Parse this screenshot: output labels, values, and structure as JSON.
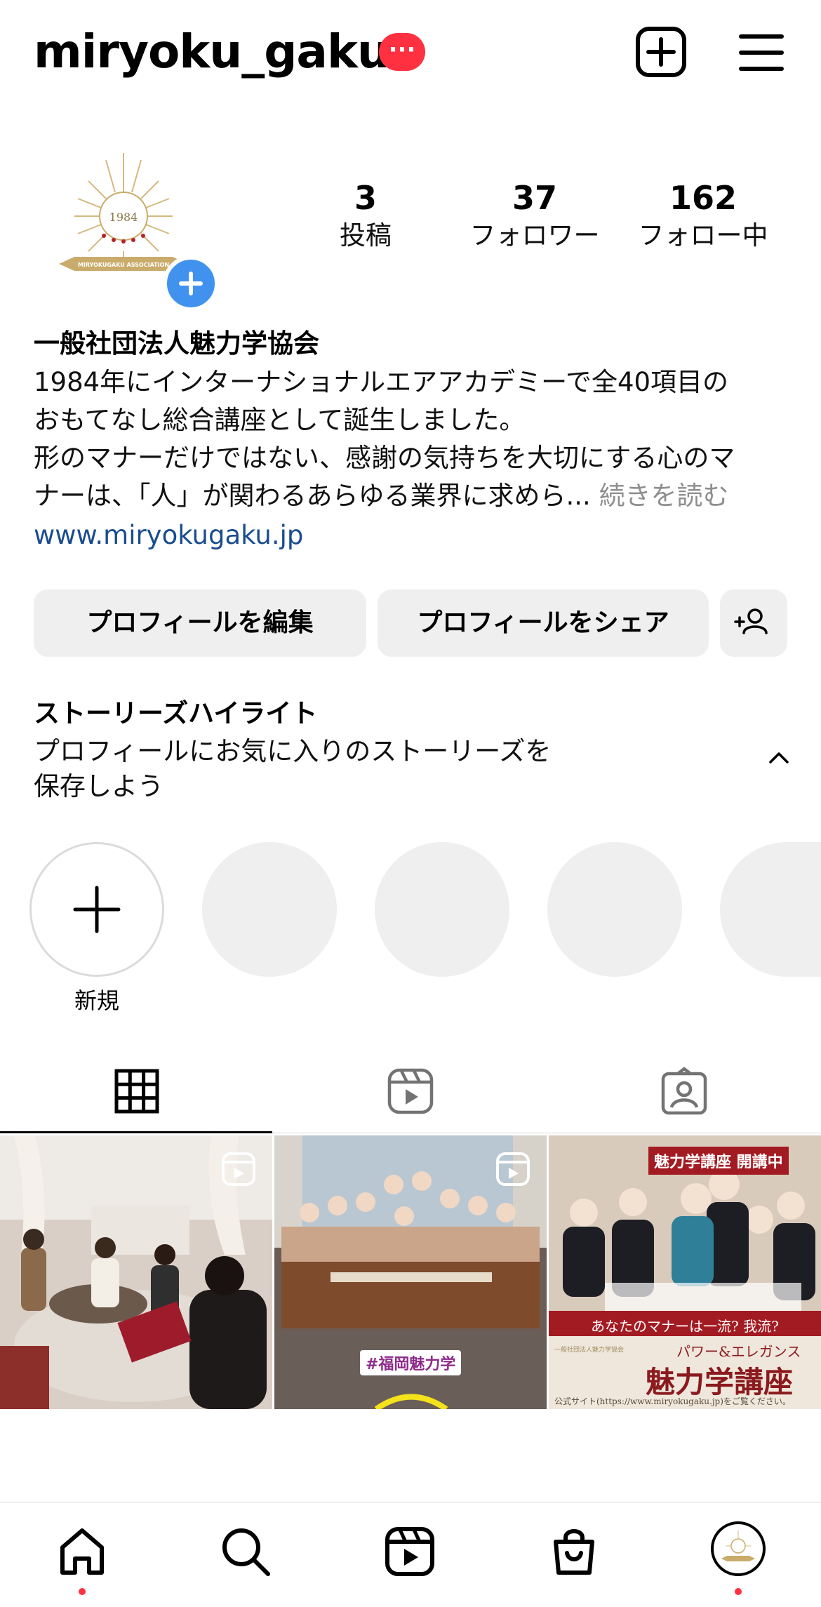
{
  "header": {
    "username": "miryoku_gaku",
    "badge": "···",
    "icons": [
      "create-icon",
      "menu-icon"
    ]
  },
  "profile": {
    "avatar_year": "1984",
    "avatar_ribbon": "MIRYOKUGAKU ASSOCIATION",
    "stats": [
      {
        "value": "3",
        "label": "投稿"
      },
      {
        "value": "37",
        "label": "フォロワー"
      },
      {
        "value": "162",
        "label": "フォロー中"
      }
    ],
    "name": "一般社団法人魅力学協会",
    "bio_lines": [
      "1984年にインターナショナルエアアカデミーで全40項目の",
      "おもてなし総合講座として誕生しました。",
      "形のマナーだけではない、感謝の気持ちを大切にする心のマ",
      "ナーは、「人」が関わるあらゆる業界に求めら..."
    ],
    "more": "続きを読む",
    "website": "www.miryokugaku.jp"
  },
  "buttons": {
    "edit": "プロフィールを編集",
    "share": "プロフィールをシェア"
  },
  "highlights": {
    "title": "ストーリーズハイライト",
    "desc_line1": "プロフィールにお気に入りのストーリーズを",
    "desc_line2": "保存しよう",
    "new_label": "新規"
  },
  "posts": [
    {
      "type": "reel",
      "caption": ""
    },
    {
      "type": "reel",
      "caption": "#福岡魅力学"
    },
    {
      "type": "image",
      "banner": "魅力学講座 開講中",
      "sub1": "あなたのマナーは一流? 我流?",
      "sub2": "パワー&エレガンス",
      "title": "魅力学講座",
      "assoc": "一般社団法人魅力学協会",
      "footer": "公式サイト(https://www.miryokugaku.jp)をご覧ください。"
    }
  ],
  "colors": {
    "accent": "#ff3040",
    "link": "#1a4d8f",
    "blue": "#4192ef",
    "button_bg": "#efefef"
  }
}
